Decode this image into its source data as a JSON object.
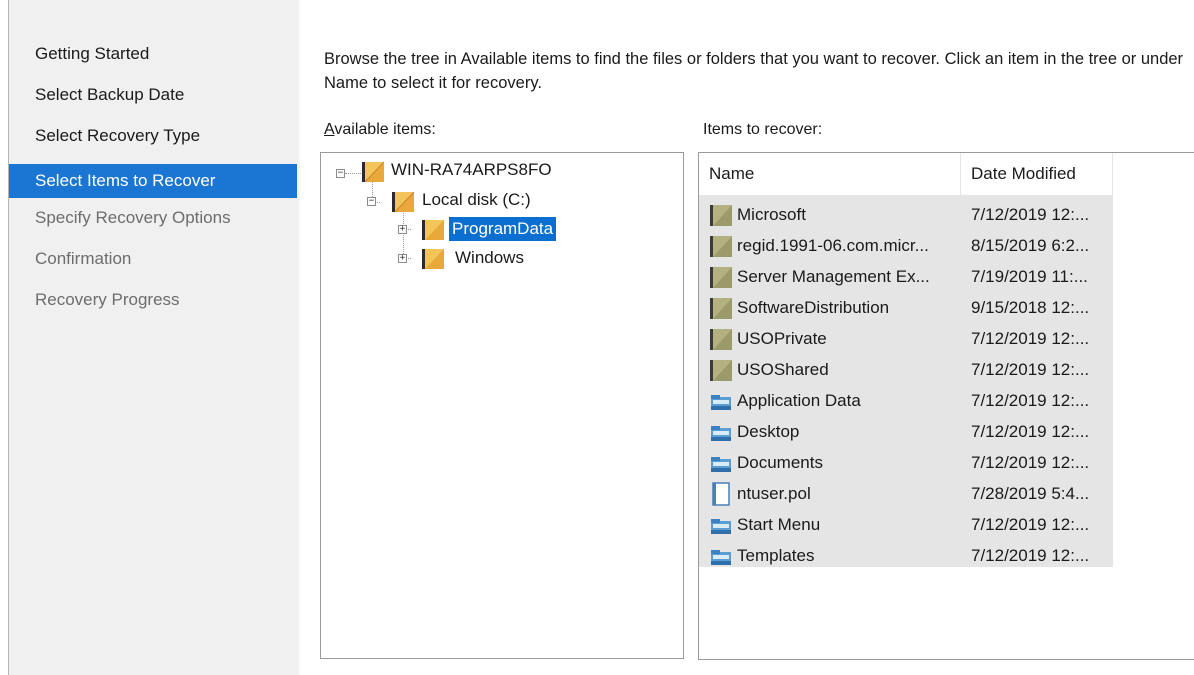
{
  "nav": {
    "items": [
      {
        "label": "Getting Started",
        "state": "done"
      },
      {
        "label": "Select Backup Date",
        "state": "done"
      },
      {
        "label": "Select Recovery Type",
        "state": "done"
      },
      {
        "label": "Select Items to Recover",
        "state": "active"
      },
      {
        "label": "Specify Recovery Options",
        "state": "pending"
      },
      {
        "label": "Confirmation",
        "state": "pending"
      },
      {
        "label": "Recovery Progress",
        "state": "pending"
      }
    ]
  },
  "main": {
    "instructions": "Browse the tree in Available items to find the files or folders that you want to recover. Click an item in the tree or under Name to select it for recovery.",
    "available_label_accel": "A",
    "available_label_rest": "vailable items:",
    "recover_label": "Items to recover:"
  },
  "tree": {
    "root": "WIN-RA74ARPS8FO",
    "disk": "Local disk (C:)",
    "children": [
      "ProgramData",
      "Windows"
    ],
    "selected": "ProgramData"
  },
  "list": {
    "columns": {
      "name": "Name",
      "date": "Date Modified"
    },
    "sort_indicator": "^",
    "rows": [
      {
        "name": "Microsoft",
        "date": "7/12/2019 12:...",
        "icon": "folder-icon"
      },
      {
        "name": "regid.1991-06.com.micr...",
        "date": "8/15/2019 6:2...",
        "icon": "folder-icon"
      },
      {
        "name": "Server Management Ex...",
        "date": "7/19/2019 11:...",
        "icon": "folder-icon"
      },
      {
        "name": "SoftwareDistribution",
        "date": "9/15/2018 12:...",
        "icon": "folder-icon"
      },
      {
        "name": "USOPrivate",
        "date": "7/12/2019 12:...",
        "icon": "folder-icon"
      },
      {
        "name": "USOShared",
        "date": "7/12/2019 12:...",
        "icon": "folder-icon"
      },
      {
        "name": "Application Data",
        "date": "7/12/2019 12:...",
        "icon": "shortcut-folder-icon"
      },
      {
        "name": "Desktop",
        "date": "7/12/2019 12:...",
        "icon": "shortcut-folder-icon"
      },
      {
        "name": "Documents",
        "date": "7/12/2019 12:...",
        "icon": "shortcut-folder-icon"
      },
      {
        "name": "ntuser.pol",
        "date": "7/28/2019 5:4...",
        "icon": "file-icon"
      },
      {
        "name": "Start Menu",
        "date": "7/12/2019 12:...",
        "icon": "shortcut-folder-icon"
      },
      {
        "name": "Templates",
        "date": "7/12/2019 12:...",
        "icon": "shortcut-folder-icon"
      }
    ]
  },
  "colors": {
    "accent": "#1a76d2",
    "selection": "#0a6fd0",
    "row_bg": "#e5e5e5",
    "folder": "#f3c45a"
  }
}
